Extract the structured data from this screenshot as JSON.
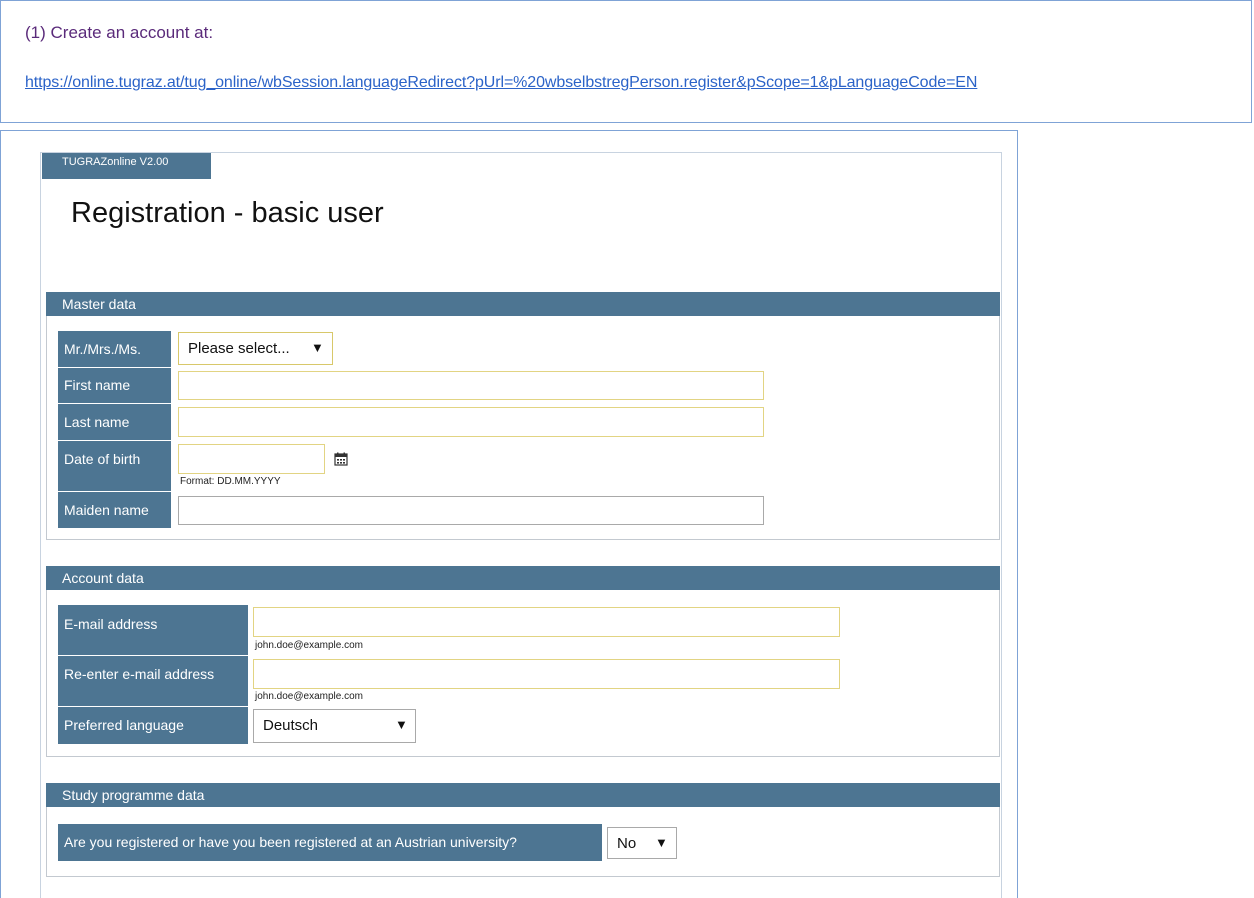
{
  "intro": {
    "step": "(1) Create an account at:",
    "link": "https://online.tugraz.at/tug_online/wbSession.languageRedirect?pUrl=%20wbselbstregPerson.register&pScope=1&pLanguageCode=EN"
  },
  "app": {
    "version": "TUGRAZonline V2.00",
    "heading": "Registration - basic user"
  },
  "master": {
    "title": "Master data",
    "salutation_label": "Mr./Mrs./Ms.",
    "salutation_value": "Please select...",
    "first_name_label": "First name",
    "last_name_label": "Last name",
    "dob_label": "Date of birth",
    "dob_hint": "Format: DD.MM.YYYY",
    "maiden_label": "Maiden name"
  },
  "account": {
    "title": "Account data",
    "email_label": "E-mail address",
    "email_hint": "john.doe@example.com",
    "reemail_label": "Re-enter e-mail address",
    "reemail_hint": "john.doe@example.com",
    "language_label": "Preferred language",
    "language_value": "Deutsch"
  },
  "study": {
    "title": "Study programme data",
    "question": "Are you registered or have you been registered at an Austrian university?",
    "answer": "No"
  },
  "icons": {
    "dropdown_arrow": "▼",
    "calendar": "calendar-icon"
  },
  "colors": {
    "header_blue": "#4d7592",
    "link_blue": "#2b63c8",
    "required_border": "#e2d483"
  }
}
